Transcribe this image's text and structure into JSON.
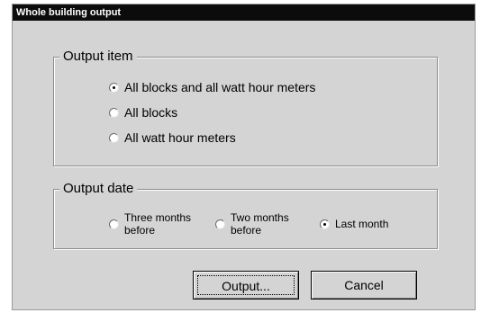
{
  "window": {
    "title": "Whole building output"
  },
  "output_item": {
    "title": "Output item",
    "options": [
      {
        "label": "All blocks and all watt hour meters",
        "selected": true
      },
      {
        "label": "All blocks",
        "selected": false
      },
      {
        "label": "All watt hour meters",
        "selected": false
      }
    ]
  },
  "output_date": {
    "title": "Output date",
    "options": [
      {
        "line1": "Three months",
        "line2": "before",
        "selected": false
      },
      {
        "line1": "Two months",
        "line2": "before",
        "selected": false
      },
      {
        "label": "Last month",
        "selected": true
      }
    ]
  },
  "buttons": {
    "output": "Output...",
    "cancel": "Cancel"
  }
}
